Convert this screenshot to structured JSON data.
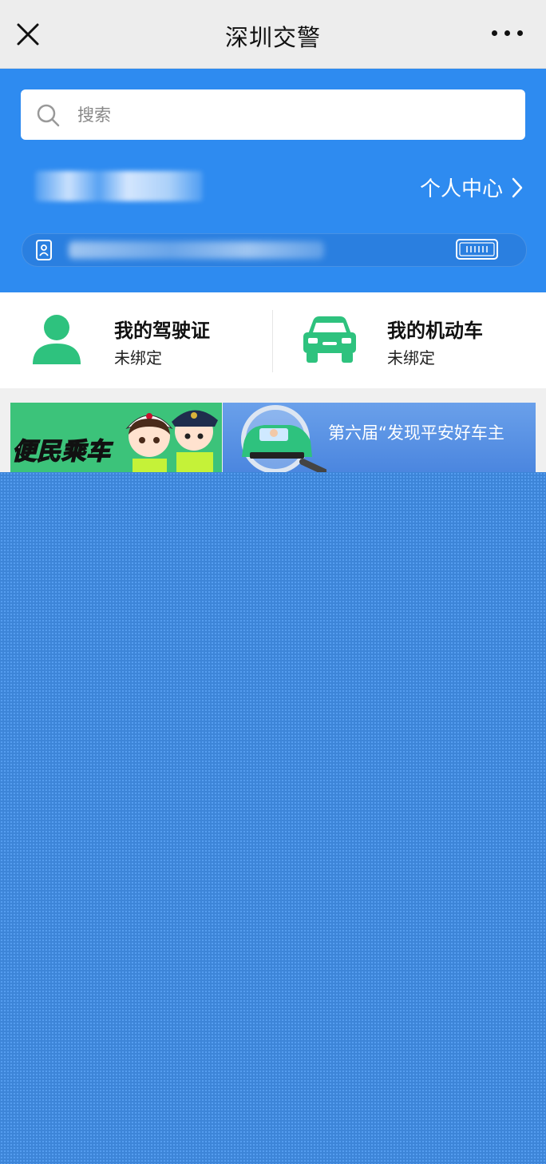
{
  "topbar": {
    "title": "深圳交警",
    "close_icon": "close-icon",
    "more_icon": "more-icon"
  },
  "search": {
    "placeholder": "搜索",
    "icon": "search-icon"
  },
  "user": {
    "personal_center_label": "个人中心",
    "chevron_icon": "chevron-right-icon",
    "id_icon": "id-card-icon",
    "scan_icon": "license-plate-icon"
  },
  "cards": [
    {
      "title": "我的驾驶证",
      "status": "未绑定",
      "icon": "person-icon",
      "color": "#2ec27e"
    },
    {
      "title": "我的机动车",
      "status": "未绑定",
      "icon": "car-icon",
      "color": "#2ec27e"
    }
  ],
  "banners": [
    {
      "text": "便民乘车"
    },
    {
      "text": "第六届“发现平安好车主"
    }
  ],
  "colors": {
    "header_blue": "#2e8bf0",
    "accent_green": "#2ec27e"
  }
}
